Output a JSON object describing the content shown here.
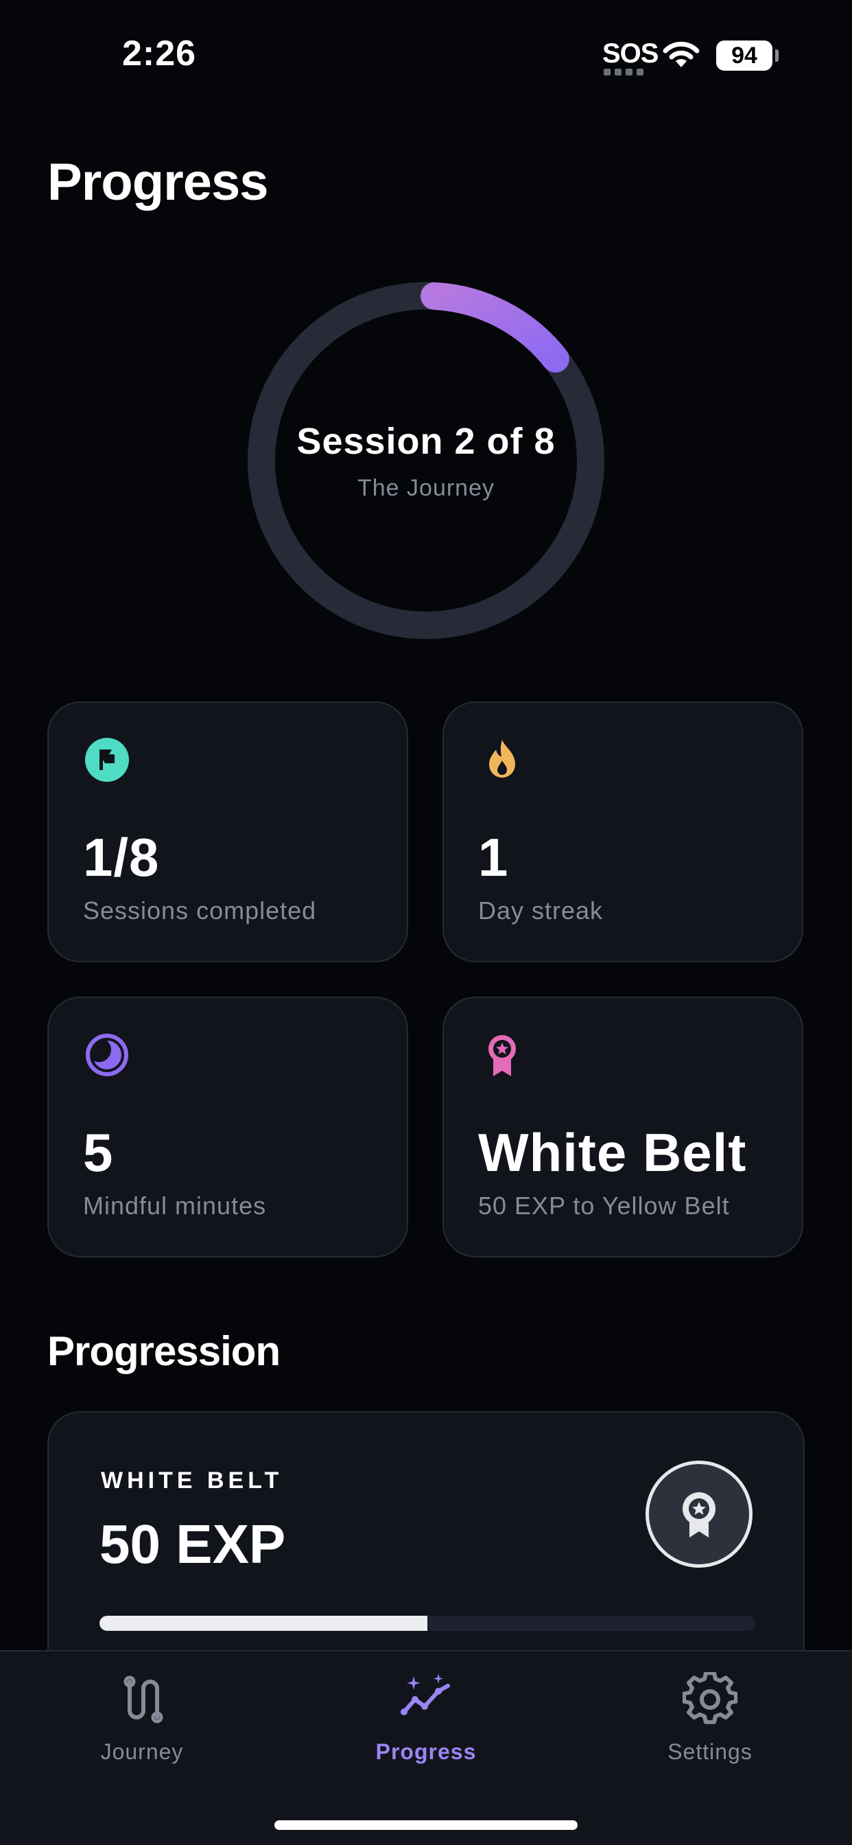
{
  "status_bar": {
    "time": "2:26",
    "sos": "SOS",
    "battery": "94"
  },
  "header": {
    "title": "Progress"
  },
  "ring": {
    "title": "Session 2 of 8",
    "subtitle": "The Journey",
    "progress_fraction": 0.125,
    "track_color": "#272b37",
    "gradient_start": "#b678e0",
    "gradient_end": "#8e6af2"
  },
  "stats": [
    {
      "value": "1/8",
      "label": "Sessions completed",
      "icon": "flag-icon",
      "color": "#4fdcc4"
    },
    {
      "value": "1",
      "label": "Day streak",
      "icon": "flame-icon",
      "color": "#f2b65a"
    },
    {
      "value": "5",
      "label": "Mindful minutes",
      "icon": "moon-clock-icon",
      "color": "#8e6af2"
    },
    {
      "value": "White Belt",
      "label": "50 EXP to Yellow Belt",
      "icon": "award-ribbon-icon",
      "color": "#e46bb9"
    }
  ],
  "progression": {
    "section_title": "Progression",
    "belt_label": "WHITE BELT",
    "exp": "50 EXP",
    "bar_fraction": 0.5
  },
  "tabs": [
    {
      "label": "Journey",
      "icon": "path-route-icon",
      "active": false
    },
    {
      "label": "Progress",
      "icon": "chart-sparkle-icon",
      "active": true
    },
    {
      "label": "Settings",
      "icon": "gear-icon",
      "active": false
    }
  ],
  "colors": {
    "background": "#05060a",
    "card": "#12141c",
    "accent": "#9a86f4",
    "muted_text": "#868b99"
  }
}
